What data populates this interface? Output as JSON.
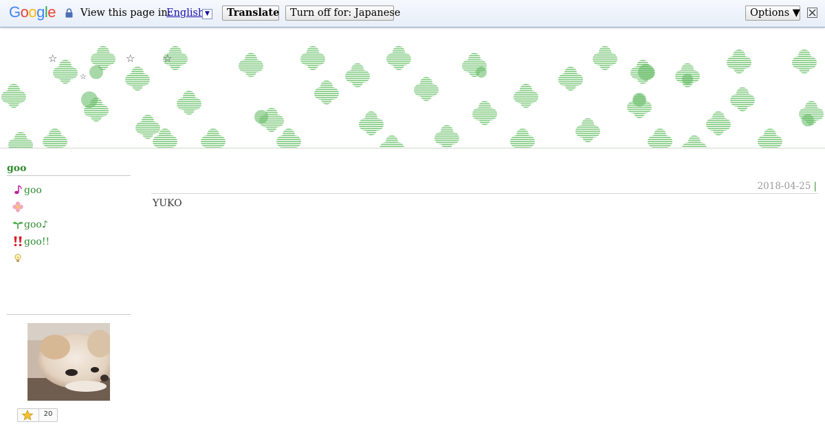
{
  "translate_bar": {
    "logo": "Google",
    "view_label": "View this page in:",
    "language": "English",
    "translate_label": "Translate",
    "turn_off_label": "Turn off for: Japanese",
    "options_label": "Options ▼"
  },
  "colors": {
    "accent_green": "#2e8b2e",
    "clover": "#7dcc7d",
    "date_gray": "#9a9a9a"
  },
  "sidebar": {
    "title": "goo",
    "items": [
      {
        "icon": "music-note-icon",
        "label": "goo"
      },
      {
        "icon": "flower-icon",
        "label": ""
      },
      {
        "icon": "sprout-icon",
        "label": "goo♪"
      },
      {
        "icon": "exclamation-icon",
        "label": "goo!!"
      },
      {
        "icon": "lightbulb-icon",
        "label": ""
      }
    ],
    "star_count": "20"
  },
  "post": {
    "date": "2018-04-25",
    "separator": "|",
    "body": "YUKO"
  }
}
